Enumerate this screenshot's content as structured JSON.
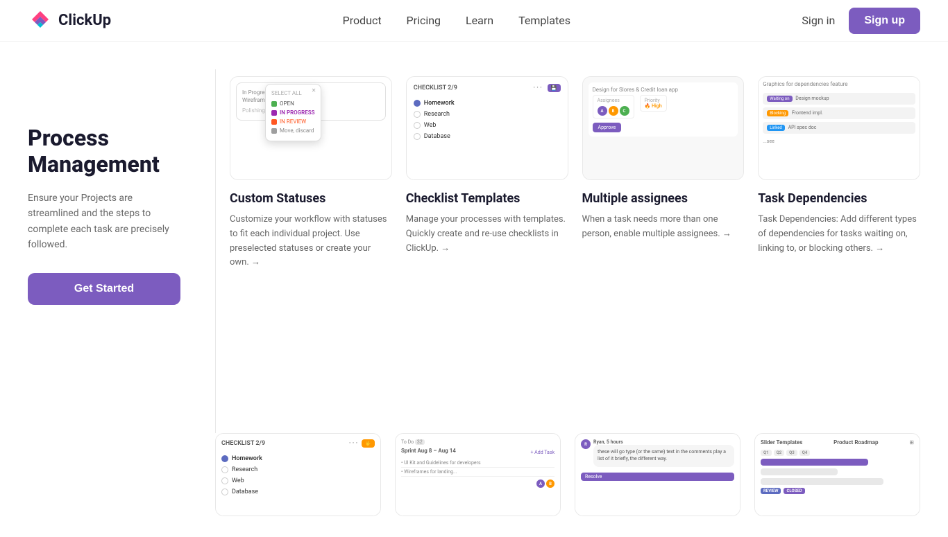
{
  "navbar": {
    "logo_text": "ClickUp",
    "links": [
      {
        "label": "Product",
        "id": "product"
      },
      {
        "label": "Pricing",
        "id": "pricing"
      },
      {
        "label": "Learn",
        "id": "learn"
      },
      {
        "label": "Templates",
        "id": "templates"
      }
    ],
    "signin_label": "Sign in",
    "signup_label": "Sign up"
  },
  "sidebar": {
    "title": "Process Management",
    "description": "Ensure your Projects are streamlined and the steps to complete each task are precisely followed.",
    "cta_label": "Get Started"
  },
  "features": [
    {
      "id": "custom-statuses",
      "title": "Custom Statuses",
      "description": "Customize your workflow with statuses to fit each individual project. Use preselected statuses or create your own. →",
      "desc_link": "→"
    },
    {
      "id": "checklist-templates",
      "title": "Checklist Templates",
      "description": "Manage your processes with templates. Quickly create and re-use checklists in ClickUp. →",
      "desc_link": "→"
    },
    {
      "id": "multiple-assignees",
      "title": "Multiple assignees",
      "description": "When a task needs more than one person, enable multiple assignees. →",
      "desc_link": "→"
    },
    {
      "id": "task-dependencies",
      "title": "Task Dependencies",
      "description": "Task Dependencies: Add different types of dependencies for tasks waiting on, linking to, or blocking others. →",
      "desc_link": "→"
    }
  ],
  "mock": {
    "checklist_label": "CHECKLIST 2/9",
    "checklist_items": [
      "Homework",
      "Research",
      "Web",
      "Database"
    ],
    "statuses": [
      "OPEN",
      "IN PROGRESS",
      "IN REVIEW"
    ],
    "sprint_label": "Sprint Aug 8 – Aug 14",
    "todo_label": "To Do",
    "roadmap_title": "Slider Templates",
    "roadmap_subtitle": "Product Roadmap"
  }
}
